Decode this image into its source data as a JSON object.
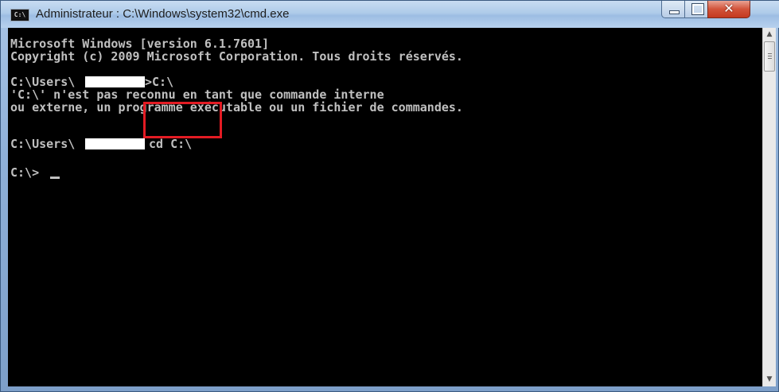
{
  "window": {
    "title": "Administrateur : C:\\Windows\\system32\\cmd.exe",
    "icon_text": "C:\\"
  },
  "controls": {
    "minimize": "minimize",
    "maximize": "maximize",
    "close_glyph": "✕"
  },
  "console": {
    "lines": {
      "l1": "Microsoft Windows [version 6.1.7601]",
      "l2": "Copyright (c) 2009 Microsoft Corporation. Tous droits réservés.",
      "l3a": "C:\\Users\\",
      "l3b": ">C:\\",
      "l4": "'C:\\' n'est pas reconnu en tant que commande interne",
      "l5": "ou externe, un programme exécutable ou un fichier de commandes.",
      "l6a": "C:\\Users\\",
      "l6b": "cd C:\\",
      "l7": "C:\\>"
    }
  },
  "scrollbar": {
    "up": "▲",
    "down": "▼"
  },
  "colors": {
    "console_bg": "#000000",
    "console_text": "#c0c0c0",
    "highlight": "#e31b23"
  }
}
